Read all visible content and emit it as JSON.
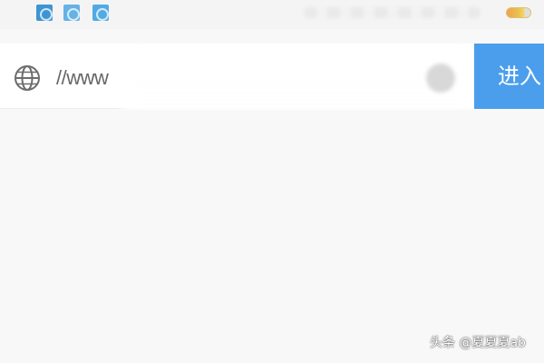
{
  "status_bar": {
    "notification_icons": [
      "app-notification-icon",
      "app-notification-icon",
      "app-notification-icon"
    ],
    "battery_icon": "battery-icon"
  },
  "address_bar": {
    "globe_icon": "globe-icon",
    "url_prefix": "//www",
    "url_obscured": "",
    "clear_icon": "clear-icon",
    "enter_label": "进入",
    "enter_color": "#4a9eec"
  },
  "watermark": {
    "text": "头条 @夏夏夏ab"
  }
}
